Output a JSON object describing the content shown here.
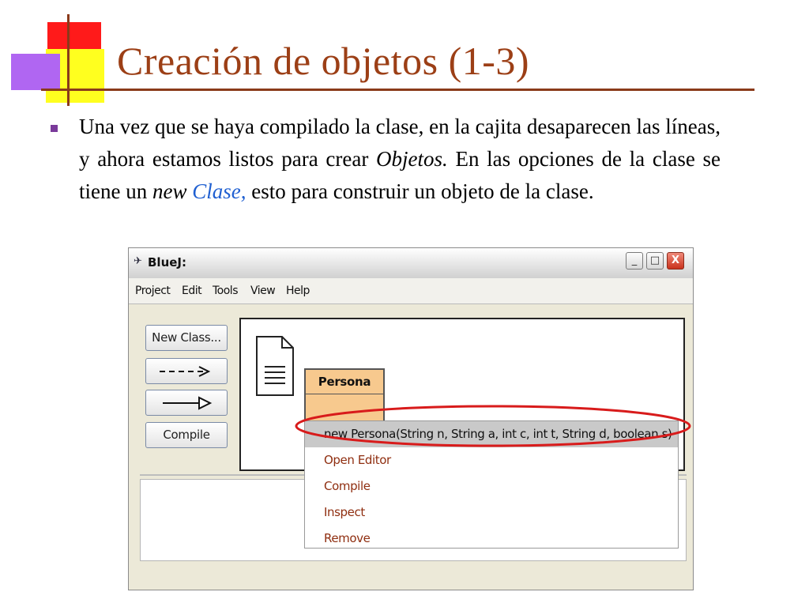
{
  "slide": {
    "title": "Creación de objetos  (1-3)",
    "text_part1": "Una vez que se haya compilado la clase, en la cajita desaparecen las líneas, y ahora estamos listos para crear ",
    "text_objetos": "Objetos.",
    "text_part2": " En las opciones de la clase se tiene un ",
    "text_new": "new",
    "text_clase": "Clase,",
    "text_part3": " esto para construir un objeto de la clase."
  },
  "window": {
    "title": "BlueJ:",
    "icon": "bluej-bird-icon",
    "controls": {
      "minimize": "_",
      "maximize": "□",
      "close": "X"
    }
  },
  "menubar": [
    "Project",
    "Edit",
    "Tools",
    "View",
    "Help"
  ],
  "toolbar": {
    "new_class": "New Class...",
    "dependency_arrow": "- - ->",
    "inheritance_arrow": "—▷",
    "compile": "Compile"
  },
  "class_box": {
    "name": "Persona"
  },
  "context_menu": {
    "items": [
      "new Persona(String n, String a, int c, int t, String d, boolean s)",
      "Open Editor",
      "Compile",
      "Inspect",
      "Remove"
    ]
  },
  "colors": {
    "title": "#9c3f16",
    "highlight": "#d81b1b",
    "class_fill": "#f7c98e",
    "menu_text": "#8f2e10",
    "link_blue": "#1f5fd1"
  }
}
